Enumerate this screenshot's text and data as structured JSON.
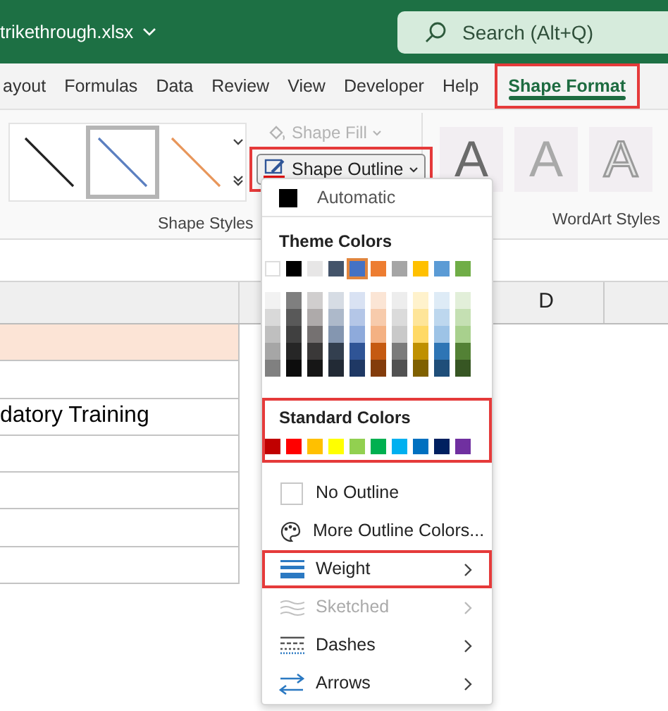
{
  "title_bar": {
    "file_name": "trikethrough.xlsx",
    "search": {
      "placeholder": "Search (Alt+Q)"
    }
  },
  "tabs": [
    {
      "label": "ayout",
      "selected": false,
      "highlighted": false
    },
    {
      "label": "Formulas",
      "selected": false,
      "highlighted": false
    },
    {
      "label": "Data",
      "selected": false,
      "highlighted": false
    },
    {
      "label": "Review",
      "selected": false,
      "highlighted": false
    },
    {
      "label": "View",
      "selected": false,
      "highlighted": false
    },
    {
      "label": "Developer",
      "selected": false,
      "highlighted": false
    },
    {
      "label": "Help",
      "selected": false,
      "highlighted": false
    },
    {
      "label": "Shape Format",
      "selected": true,
      "highlighted": true
    }
  ],
  "ribbon": {
    "shape_styles": {
      "label": "Shape Styles",
      "thumbnails": [
        {
          "color": "#222222",
          "selected": false
        },
        {
          "color": "#5b7fc0",
          "selected": true
        },
        {
          "color": "#e8965a",
          "selected": false
        }
      ]
    },
    "shape_fill": {
      "label": "Shape Fill",
      "disabled": true
    },
    "shape_outline": {
      "label": "Shape Outline",
      "highlighted": true
    },
    "wordart_styles": {
      "label": "WordArt Styles",
      "letters": [
        "A",
        "A",
        "A"
      ]
    }
  },
  "sheet": {
    "column_header": "D",
    "rows": [
      {
        "text": "",
        "color": "#fce4d6"
      },
      {
        "text": ""
      },
      {
        "text": "datory Training"
      },
      {
        "text": ""
      },
      {
        "text": ""
      },
      {
        "text": ""
      },
      {
        "text": ""
      }
    ]
  },
  "outline_menu": {
    "automatic": {
      "label": "Automatic",
      "color": "#000000"
    },
    "theme_colors": {
      "heading": "Theme Colors",
      "colors": [
        {
          "color": "#ffffff",
          "selected": false,
          "shades": [
            {
              "color": "#f2f2f2"
            },
            {
              "color": "#d9d9d9"
            },
            {
              "color": "#bfbfbf"
            },
            {
              "color": "#a6a6a6"
            },
            {
              "color": "#808080"
            }
          ]
        },
        {
          "color": "#000000",
          "selected": false,
          "shades": [
            {
              "color": "#7f7f7f"
            },
            {
              "color": "#595959"
            },
            {
              "color": "#404040"
            },
            {
              "color": "#262626"
            },
            {
              "color": "#0d0d0d"
            }
          ]
        },
        {
          "color": "#e7e6e6",
          "selected": false,
          "shades": [
            {
              "color": "#d0cece"
            },
            {
              "color": "#aeaaaa"
            },
            {
              "color": "#757171"
            },
            {
              "color": "#3a3838"
            },
            {
              "color": "#161616"
            }
          ]
        },
        {
          "color": "#44546a",
          "selected": false,
          "shades": [
            {
              "color": "#d6dce4"
            },
            {
              "color": "#adb9ca"
            },
            {
              "color": "#8496b0"
            },
            {
              "color": "#333f4f"
            },
            {
              "color": "#222a35"
            }
          ]
        },
        {
          "color": "#4472c4",
          "selected": true,
          "shades": [
            {
              "color": "#d9e2f3"
            },
            {
              "color": "#b4c6e7"
            },
            {
              "color": "#8eaadb"
            },
            {
              "color": "#2f5496"
            },
            {
              "color": "#1f3864"
            }
          ]
        },
        {
          "color": "#ed7d31",
          "selected": false,
          "shades": [
            {
              "color": "#fbe5d5"
            },
            {
              "color": "#f7cbac"
            },
            {
              "color": "#f4b183"
            },
            {
              "color": "#c55a11"
            },
            {
              "color": "#833c0b"
            }
          ]
        },
        {
          "color": "#a5a5a5",
          "selected": false,
          "shades": [
            {
              "color": "#ededed"
            },
            {
              "color": "#dbdbdb"
            },
            {
              "color": "#c9c9c9"
            },
            {
              "color": "#7b7b7b"
            },
            {
              "color": "#525252"
            }
          ]
        },
        {
          "color": "#ffc000",
          "selected": false,
          "shades": [
            {
              "color": "#fff2cc"
            },
            {
              "color": "#fee599"
            },
            {
              "color": "#ffd965"
            },
            {
              "color": "#bf9000"
            },
            {
              "color": "#7f6000"
            }
          ]
        },
        {
          "color": "#5b9bd5",
          "selected": false,
          "shades": [
            {
              "color": "#deebf6"
            },
            {
              "color": "#bdd7ee"
            },
            {
              "color": "#9dc3e6"
            },
            {
              "color": "#2e75b5"
            },
            {
              "color": "#1f4e79"
            }
          ]
        },
        {
          "color": "#70ad47",
          "selected": false,
          "shades": [
            {
              "color": "#e2efd9"
            },
            {
              "color": "#c5e0b3"
            },
            {
              "color": "#a8d08d"
            },
            {
              "color": "#538135"
            },
            {
              "color": "#375623"
            }
          ]
        }
      ]
    },
    "standard_colors": {
      "heading": "Standard Colors",
      "highlighted": true,
      "colors": [
        {
          "color": "#c00000"
        },
        {
          "color": "#ff0000"
        },
        {
          "color": "#ffc000"
        },
        {
          "color": "#ffff00"
        },
        {
          "color": "#92d050"
        },
        {
          "color": "#00b050"
        },
        {
          "color": "#00b0f0"
        },
        {
          "color": "#0070c0"
        },
        {
          "color": "#002060"
        },
        {
          "color": "#7030a0"
        }
      ]
    },
    "items": [
      {
        "label": "No Outline",
        "kind": "checkbox",
        "disabled": false,
        "submenu": false,
        "highlighted": false
      },
      {
        "label": "More Outline Colors...",
        "kind": "palette",
        "disabled": false,
        "submenu": false,
        "highlighted": false
      },
      {
        "label": "Weight",
        "kind": "weight",
        "disabled": false,
        "submenu": true,
        "highlighted": true
      },
      {
        "label": "Sketched",
        "kind": "sketched",
        "disabled": true,
        "submenu": true,
        "highlighted": false
      },
      {
        "label": "Dashes",
        "kind": "dashes",
        "disabled": false,
        "submenu": true,
        "highlighted": false
      },
      {
        "label": "Arrows",
        "kind": "arrows",
        "disabled": false,
        "submenu": true,
        "highlighted": false
      }
    ]
  }
}
